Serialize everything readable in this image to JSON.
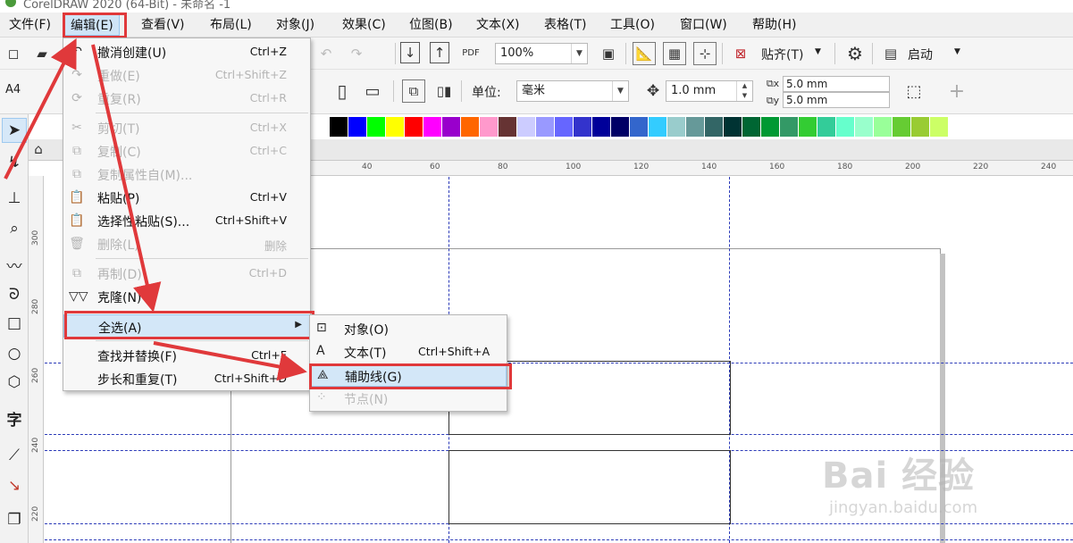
{
  "titlebar": {
    "title": "CorelDRAW 2020 (64-Bit) - 未命名 -1"
  },
  "menubar": {
    "items": [
      {
        "label": "文件(F)"
      },
      {
        "label": "编辑(E)"
      },
      {
        "label": "查看(V)"
      },
      {
        "label": "布局(L)"
      },
      {
        "label": "对象(J)"
      },
      {
        "label": "效果(C)"
      },
      {
        "label": "位图(B)"
      },
      {
        "label": "文本(X)"
      },
      {
        "label": "表格(T)"
      },
      {
        "label": "工具(O)"
      },
      {
        "label": "窗口(W)"
      },
      {
        "label": "帮助(H)"
      }
    ]
  },
  "toolbar": {
    "zoom": "100%",
    "snap_label": "贴齐(T)",
    "launch_label": "启动",
    "page_size": "A4",
    "unit_label": "单位:",
    "unit_value": "毫米",
    "nudge": "1.0 mm",
    "dup_x": "5.0 mm",
    "dup_y": "5.0 mm"
  },
  "edit_menu": {
    "items": [
      {
        "label": "撤消创建(U)",
        "shortcut": "Ctrl+Z",
        "enabled": true,
        "icon": "undo-icon"
      },
      {
        "label": "重做(E)",
        "shortcut": "Ctrl+Shift+Z",
        "enabled": false,
        "icon": "redo-icon"
      },
      {
        "label": "重复(R)",
        "shortcut": "Ctrl+R",
        "enabled": false,
        "icon": "repeat-icon"
      },
      {
        "label": "剪切(T)",
        "shortcut": "Ctrl+X",
        "enabled": false,
        "icon": "cut-icon"
      },
      {
        "label": "复制(C)",
        "shortcut": "Ctrl+C",
        "enabled": false,
        "icon": "copy-icon"
      },
      {
        "label": "复制属性自(M)...",
        "shortcut": "",
        "enabled": false,
        "icon": "copy-properties-icon"
      },
      {
        "label": "粘贴(P)",
        "shortcut": "Ctrl+V",
        "enabled": true,
        "icon": "paste-icon"
      },
      {
        "label": "选择性粘贴(S)...",
        "shortcut": "Ctrl+Shift+V",
        "enabled": true,
        "icon": "paste-special-icon"
      },
      {
        "label": "删除(L)",
        "shortcut": "删除",
        "enabled": false,
        "icon": "delete-icon"
      },
      {
        "label": "再制(D)",
        "shortcut": "Ctrl+D",
        "enabled": false,
        "icon": "duplicate-icon"
      },
      {
        "label": "克隆(N)",
        "shortcut": "",
        "enabled": true,
        "icon": "clone-icon"
      },
      {
        "label": "全选(A)",
        "shortcut": "",
        "enabled": true,
        "icon": ""
      },
      {
        "label": "查找并替换(F)",
        "shortcut": "Ctrl+F",
        "enabled": true,
        "icon": ""
      },
      {
        "label": "步长和重复(T)",
        "shortcut": "Ctrl+Shift+D",
        "enabled": true,
        "icon": ""
      }
    ]
  },
  "select_all_submenu": {
    "items": [
      {
        "label": "对象(O)",
        "shortcut": "",
        "enabled": true,
        "icon": "select-objects-icon"
      },
      {
        "label": "文本(T)",
        "shortcut": "Ctrl+Shift+A",
        "enabled": true,
        "icon": "select-text-icon"
      },
      {
        "label": "辅助线(G)",
        "shortcut": "",
        "enabled": true,
        "icon": "select-guidelines-icon"
      },
      {
        "label": "节点(N)",
        "shortcut": "",
        "enabled": false,
        "icon": "select-nodes-icon"
      }
    ]
  },
  "rulers": {
    "h_ticks": [
      "40",
      "60",
      "80",
      "100",
      "120",
      "140",
      "160",
      "180",
      "200",
      "220",
      "240"
    ],
    "v_ticks": [
      "300",
      "280",
      "260",
      "240",
      "220"
    ]
  },
  "palette_colors": [
    "#ffffff",
    "#000000",
    "#0000ff",
    "#00ff00",
    "#ffff00",
    "#ff0000",
    "#ff00ff",
    "#9900cc",
    "#ff6600",
    "#ff99cc",
    "#663333",
    "#ccccff",
    "#9999ff",
    "#6666ff",
    "#3333cc",
    "#000099",
    "#000066",
    "#3366cc",
    "#33ccff",
    "#99cccc",
    "#669999",
    "#336666",
    "#003333",
    "#006633",
    "#009933",
    "#339966",
    "#33cc33",
    "#33cc99",
    "#66ffcc",
    "#99ffcc",
    "#99ff99",
    "#66cc33",
    "#99cc33",
    "#ccff66"
  ],
  "watermark": {
    "main": "Bai 经验",
    "sub": "jingyan.baidu.com"
  }
}
